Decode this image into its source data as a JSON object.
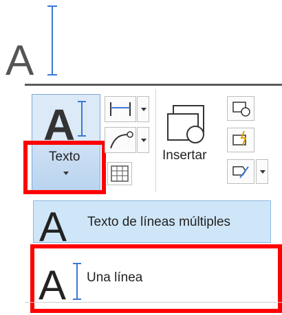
{
  "preview_icon": {
    "name": "single-line-text-icon",
    "glyph": "A"
  },
  "ribbon": {
    "texto_button": {
      "label": "Texto",
      "icon": "text-large-A-icon"
    },
    "insertar_button": {
      "label": "Insertar",
      "icon": "insert-block-icon"
    },
    "small_buttons": [
      {
        "icon": "linear-dimension-icon"
      },
      {
        "icon": "leader-icon"
      },
      {
        "icon": "table-icon"
      },
      {
        "icon": "create-block-icon"
      },
      {
        "icon": "edit-block-icon"
      },
      {
        "icon": "edit-attributes-icon"
      }
    ]
  },
  "dropdown": {
    "items": [
      {
        "label": "Texto de líneas múltiples",
        "icon": "multiline-text-icon",
        "highlighted": true
      },
      {
        "label": "Una línea",
        "icon": "single-line-text-icon",
        "highlighted": false
      }
    ]
  },
  "colors": {
    "highlight": "#ff0000",
    "button_hover": "#cfe6f8",
    "accent_blue": "#3a78d6"
  }
}
